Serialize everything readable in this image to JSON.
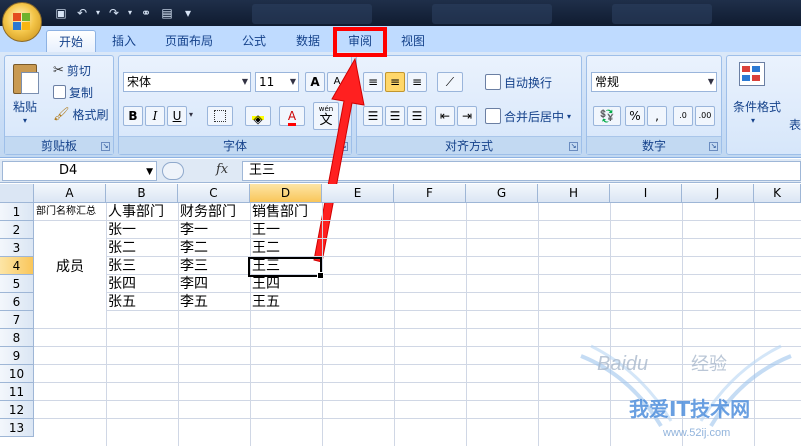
{
  "quick_access": {
    "icons": [
      "save-icon",
      "undo-icon",
      "redo-icon",
      "link-icon",
      "form-icon"
    ],
    "more": "▾"
  },
  "tabs": [
    "开始",
    "插入",
    "页面布局",
    "公式",
    "数据",
    "审阅",
    "视图"
  ],
  "active_tab": "开始",
  "highlighted_tab": "审阅",
  "clipboard": {
    "paste": "粘贴",
    "cut": "剪切",
    "copy": "复制",
    "format_painter": "格式刷",
    "label": "剪贴板"
  },
  "font": {
    "name": "宋体",
    "size": "11",
    "grow": "A",
    "shrink": "A",
    "bold": "B",
    "italic": "I",
    "underline": "U",
    "color_a": "A",
    "phonetic": "wén",
    "phonetic_char": "文",
    "label": "字体"
  },
  "alignment": {
    "wrap": "自动换行",
    "merge": "合并后居中",
    "label": "对齐方式"
  },
  "number": {
    "format": "常规",
    "percent": "%",
    "comma": ",",
    "label": "数字"
  },
  "styles": {
    "conditional": "条件格式",
    "table": "表"
  },
  "formula_bar": {
    "name_box": "D4",
    "fx": "fx",
    "value": "王三"
  },
  "columns": [
    "A",
    "B",
    "C",
    "D",
    "E",
    "F",
    "G",
    "H",
    "I",
    "J",
    "K"
  ],
  "rows": [
    "1",
    "2",
    "3",
    "4",
    "5",
    "6",
    "7",
    "8",
    "9",
    "10",
    "11",
    "12",
    "13"
  ],
  "sheet": {
    "a1": "部门名称汇总",
    "merged_a2_a6": "成员",
    "headers": [
      "人事部门",
      "财务部门",
      "销售部门"
    ],
    "col_b": [
      "张一",
      "张二",
      "张三",
      "张四",
      "张五"
    ],
    "col_c": [
      "李一",
      "李二",
      "李三",
      "李四",
      "李五"
    ],
    "col_d": [
      "王一",
      "王二",
      "王三",
      "王四",
      "王五"
    ]
  },
  "watermark": {
    "brand": "Baidu",
    "text1": "经验",
    "text2": "我爱IT技术网",
    "url": "www.52ij.com"
  },
  "colors": {
    "highlight": "#ff0000",
    "ribbon": "#c7dcf6",
    "selected_header": "#f9c65a"
  }
}
